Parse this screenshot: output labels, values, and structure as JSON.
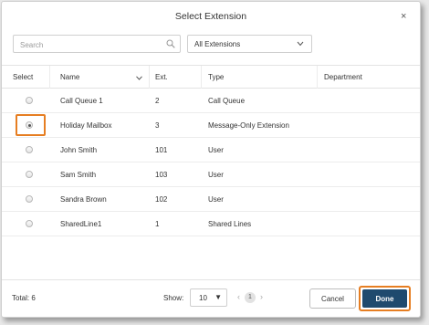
{
  "dialog": {
    "title": "Select Extension",
    "close_glyph": "×"
  },
  "search": {
    "placeholder": "Search",
    "value": ""
  },
  "filter": {
    "selected": "All Extensions"
  },
  "table": {
    "headers": {
      "select": "Select",
      "name": "Name",
      "ext": "Ext.",
      "type": "Type",
      "department": "Department"
    },
    "rows": [
      {
        "name": "Call Queue 1",
        "ext": "2",
        "type": "Call Queue",
        "department": "",
        "selected": false
      },
      {
        "name": "Holiday Mailbox",
        "ext": "3",
        "type": "Message-Only Extension",
        "department": "",
        "selected": true
      },
      {
        "name": "John Smith",
        "ext": "101",
        "type": "User",
        "department": "",
        "selected": false
      },
      {
        "name": "Sam Smith",
        "ext": "103",
        "type": "User",
        "department": "",
        "selected": false
      },
      {
        "name": "Sandra Brown",
        "ext": "102",
        "type": "User",
        "department": "",
        "selected": false
      },
      {
        "name": "SharedLine1",
        "ext": "1",
        "type": "Shared Lines",
        "department": "",
        "selected": false
      }
    ]
  },
  "footer": {
    "total": "Total: 6",
    "show_label": "Show:",
    "page_size": "10",
    "page_size_caret": "▼",
    "prev_glyph": "‹",
    "page": "1",
    "next_glyph": "›",
    "cancel_label": "Cancel",
    "done_label": "Done"
  },
  "colors": {
    "highlight": "#e67e22",
    "primary_button": "#1f4a6e"
  },
  "icons": {
    "search": "search-icon",
    "filter_chevron": "chevron-down-icon",
    "sort": "chevron-down-icon",
    "close": "close-icon"
  }
}
